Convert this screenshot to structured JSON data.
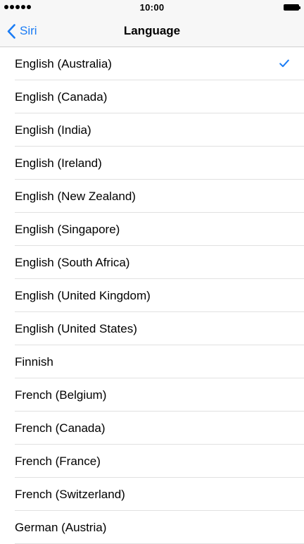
{
  "status_bar": {
    "time": "10:00"
  },
  "nav": {
    "back_label": "Siri",
    "title": "Language"
  },
  "accent_color": "#1a7cf5",
  "languages": [
    {
      "label": "English (Australia)",
      "selected": true
    },
    {
      "label": "English (Canada)",
      "selected": false
    },
    {
      "label": "English (India)",
      "selected": false
    },
    {
      "label": "English (Ireland)",
      "selected": false
    },
    {
      "label": "English (New Zealand)",
      "selected": false
    },
    {
      "label": "English (Singapore)",
      "selected": false
    },
    {
      "label": "English (South Africa)",
      "selected": false
    },
    {
      "label": "English (United Kingdom)",
      "selected": false
    },
    {
      "label": "English (United States)",
      "selected": false
    },
    {
      "label": "Finnish",
      "selected": false
    },
    {
      "label": "French (Belgium)",
      "selected": false
    },
    {
      "label": "French (Canada)",
      "selected": false
    },
    {
      "label": "French (France)",
      "selected": false
    },
    {
      "label": "French (Switzerland)",
      "selected": false
    },
    {
      "label": "German (Austria)",
      "selected": false
    }
  ]
}
